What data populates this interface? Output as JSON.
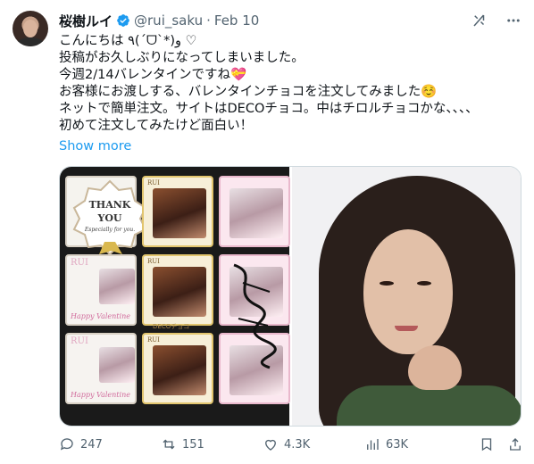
{
  "author": {
    "name": "桜樹ルイ",
    "handle": "@rui_saku",
    "separator": "·",
    "date": "Feb 10"
  },
  "tweet": {
    "text": "こんにちは ٩(ˊᗜˋ*)و ♡\n投稿がお久しぶりになってしまいました。\n今週2/14バレンタインですね💝\nお客様にお渡しする、バレンタインチョコを注文してみました☺️\nネットで簡単注文。サイトはDECOチョコ。中はチロルチョコかな、、、、\n初めて注文してみたけど面白い！",
    "show_more": "Show more"
  },
  "media": {
    "chocolate_box": {
      "badge_line1": "THANK",
      "badge_line2": "YOU",
      "badge_sub": "Especially for you.",
      "box_name": "RUI",
      "box_valentine": "Happy Valentine",
      "deco_label": "DECOチョコ"
    }
  },
  "actions": {
    "replies": "247",
    "retweets": "151",
    "likes": "4.3K",
    "views": "63K"
  },
  "colors": {
    "link": "#1d9bf0",
    "muted": "#536471",
    "verified": "#1d9bf0"
  },
  "icons": {
    "verified": "verified-badge-icon",
    "grok": "grok-icon",
    "more": "more-icon",
    "reply": "reply-icon",
    "retweet": "retweet-icon",
    "like": "heart-icon",
    "views": "views-icon",
    "bookmark": "bookmark-icon",
    "share": "share-icon"
  }
}
